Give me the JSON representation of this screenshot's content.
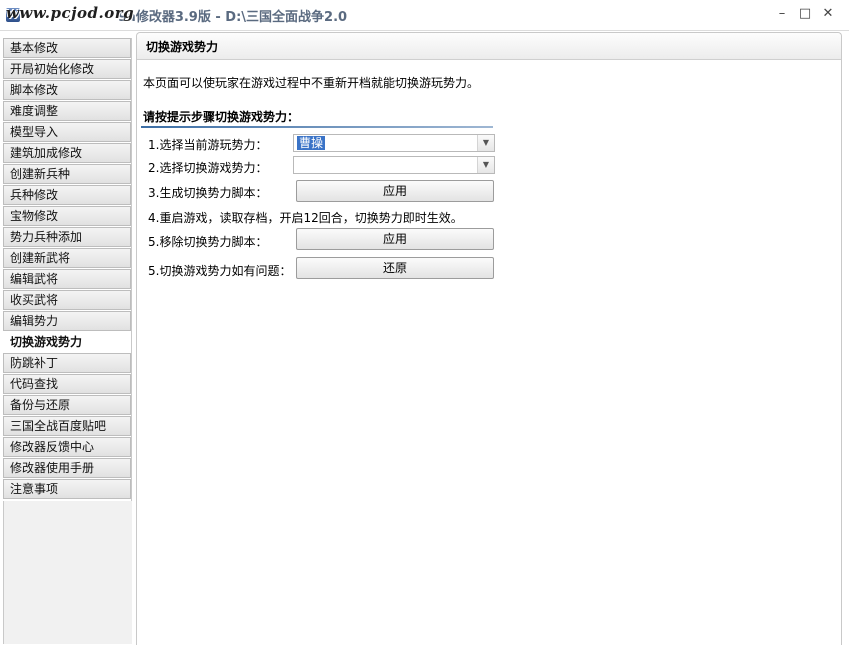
{
  "window": {
    "watermark": "www.pcjod.org",
    "title": "9a修改器3.9版 - D:\\三国全面战争2.0",
    "controls": {
      "minimize": "–",
      "maximize": "□",
      "close": "✕"
    }
  },
  "sidebar": {
    "items": [
      {
        "label": "基本修改"
      },
      {
        "label": "开局初始化修改"
      },
      {
        "label": "脚本修改"
      },
      {
        "label": "难度调整"
      },
      {
        "label": "模型导入"
      },
      {
        "label": "建筑加成修改"
      },
      {
        "label": "创建新兵种"
      },
      {
        "label": "兵种修改"
      },
      {
        "label": "宝物修改"
      },
      {
        "label": "势力兵种添加"
      },
      {
        "label": "创建新武将"
      },
      {
        "label": "编辑武将"
      },
      {
        "label": "收买武将"
      },
      {
        "label": "编辑势力"
      },
      {
        "label": "切换游戏势力",
        "active": true
      },
      {
        "label": "防跳补丁"
      },
      {
        "label": "代码查找"
      },
      {
        "label": "备份与还原"
      },
      {
        "label": "三国全战百度贴吧"
      },
      {
        "label": "修改器反馈中心"
      },
      {
        "label": "修改器使用手册"
      },
      {
        "label": "注意事项"
      }
    ]
  },
  "panel": {
    "title": "切换游戏势力",
    "description": "本页面可以使玩家在游戏过程中不重新开档就能切换游玩势力。",
    "section_heading": "请按提示步骤切换游戏势力：",
    "steps": {
      "step1_label": "1.选择当前游玩势力：",
      "step1_value": "曹操",
      "step2_label": "2.选择切换游戏势力：",
      "step2_value": "",
      "step3_label": "3.生成切换势力脚本：",
      "step3_button": "应用",
      "step4_note": "4.重启游戏，读取存档，开启12回合，切换势力即时生效。",
      "step5a_label": "5.移除切换势力脚本：",
      "step5a_button": "应用",
      "step5b_label": "5.切换游戏势力如有问题：",
      "step5b_button": "还原"
    },
    "dropdown_arrow": "▼"
  }
}
